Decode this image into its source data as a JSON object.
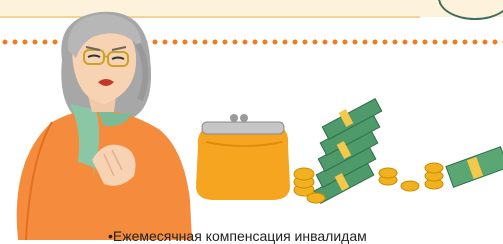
{
  "caption": {
    "text": "•Ежемесячная компенсация инвалидам"
  },
  "colors": {
    "accent_orange": "#f07c1b",
    "top_band": "#fdf3dc",
    "corner_line": "#3f6f5a"
  },
  "icons": [
    "woman-illustration",
    "purse-icon",
    "money-stack-icon",
    "coins-icon",
    "banknote-icon"
  ]
}
